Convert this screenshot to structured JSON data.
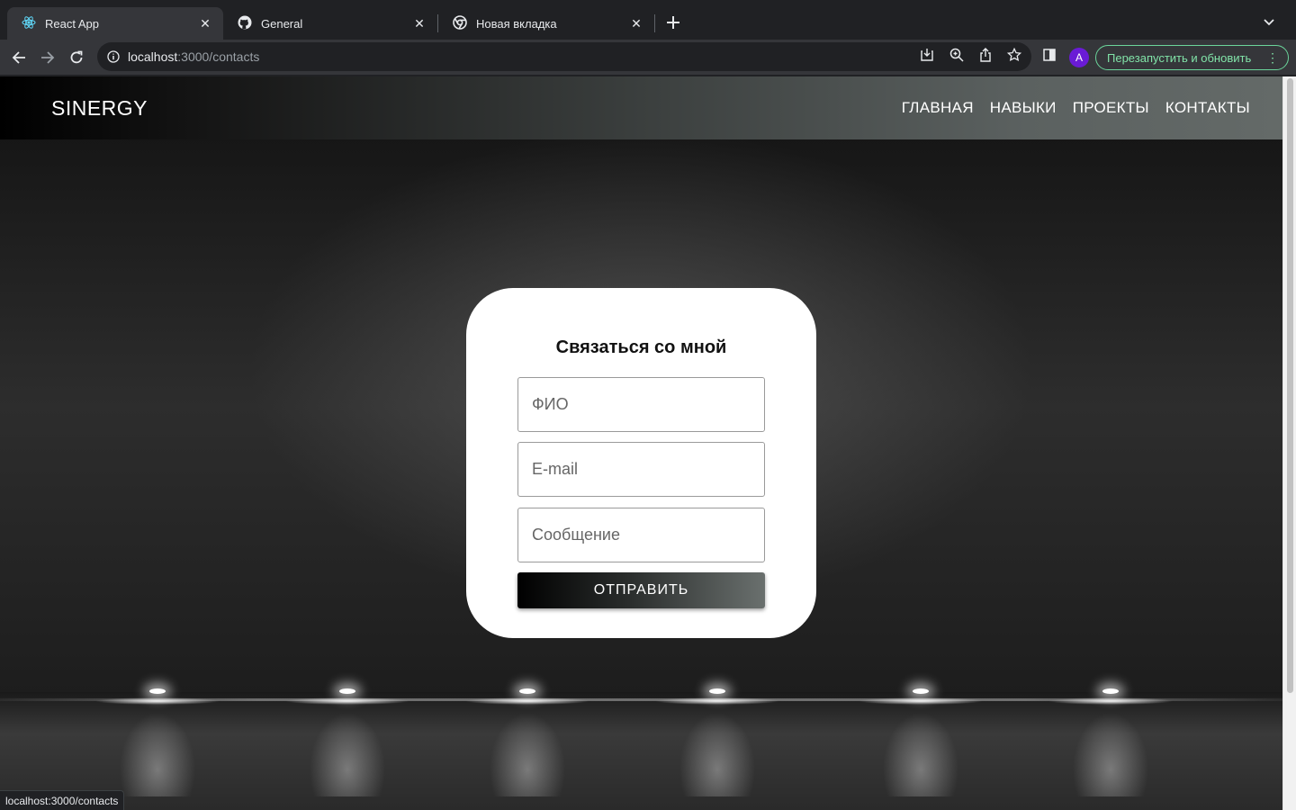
{
  "browser": {
    "tabs": [
      {
        "title": "React App",
        "icon": "react-icon",
        "active": true
      },
      {
        "title": "General",
        "icon": "github-icon",
        "active": false
      },
      {
        "title": "Новая вкладка",
        "icon": "chrome-icon",
        "active": false
      }
    ],
    "url_host": "localhost",
    "url_path": ":3000/contacts",
    "avatar_letter": "A",
    "relaunch_label": "Перезапустить и обновить",
    "status_url": "localhost:3000/contacts"
  },
  "site": {
    "brand": "SINERGY",
    "nav": [
      "ГЛАВНАЯ",
      "НАВЫКИ",
      "ПРОЕКТЫ",
      "КОНТАКТЫ"
    ]
  },
  "contact_form": {
    "title": "Связаться со мной",
    "name_placeholder": "ФИО",
    "email_placeholder": "E-mail",
    "message_placeholder": "Сообщение",
    "submit_label": "ОТПРАВИТЬ"
  },
  "colors": {
    "relaunch_accent": "#81e3a8",
    "avatar": "#6a1bd6"
  }
}
